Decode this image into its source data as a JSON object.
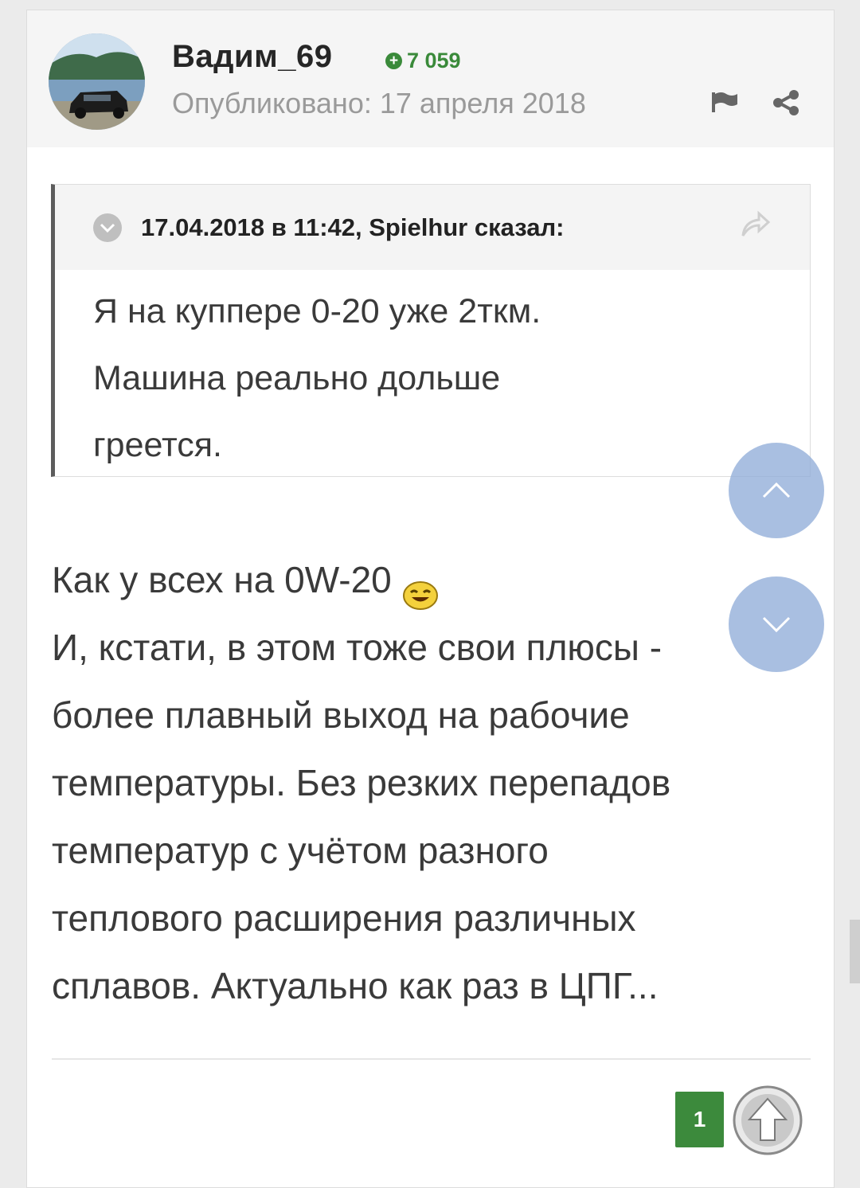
{
  "post": {
    "author": "Вадим_69",
    "reputation": "7 059",
    "published": "Опубликовано: 17 апреля 2018"
  },
  "quote": {
    "citation": "17.04.2018 в 11:42, Spielhur сказал:",
    "lines": [
      "Я на куппере 0-20 уже 2ткм.",
      "Машина реально дольше",
      "греется."
    ]
  },
  "body": {
    "lines": [
      "Как у всех на 0W-20",
      "И, кстати, в этом тоже свои плюсы -",
      "более плавный выход на рабочие",
      "температуры. Без резких перепадов",
      "температур с учётом разного",
      "теплового расширения различных",
      "сплавов. Актуально как раз в ЦПГ..."
    ],
    "emoji": "laughing-smiley-icon"
  },
  "footer": {
    "reputation_count": "1"
  },
  "icons": {
    "report": "flag-icon",
    "share": "share-icon",
    "quote_share": "reply-arrow-icon",
    "scroll_up": "chevron-up-icon",
    "scroll_down": "chevron-down-icon",
    "like": "arrow-up-icon"
  },
  "colors": {
    "reputation_green": "#3a8a3a",
    "quote_border": "#5c5c5c",
    "scroll_button": "#8caad7"
  }
}
